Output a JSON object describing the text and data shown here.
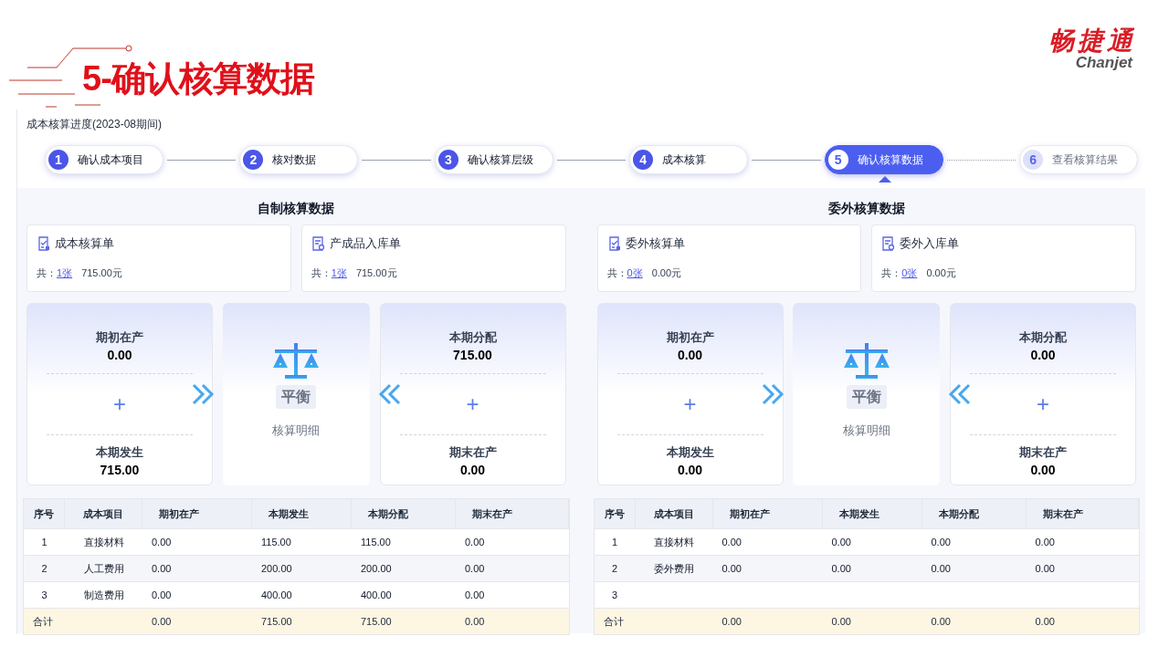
{
  "slide_title": "5-确认核算数据",
  "logo": {
    "name": "畅捷通",
    "latin": "Chanjet"
  },
  "progress": {
    "label": "成本核算进度(2023-08期间)",
    "steps": [
      {
        "number": "1",
        "label": "确认成本项目",
        "selected": false,
        "disabled": false
      },
      {
        "number": "2",
        "label": "核对数据",
        "selected": false,
        "disabled": false
      },
      {
        "number": "3",
        "label": "确认核算层级",
        "selected": false,
        "disabled": false
      },
      {
        "number": "4",
        "label": "成本核算",
        "selected": false,
        "disabled": false
      },
      {
        "number": "5",
        "label": "确认核算数据",
        "selected": true,
        "disabled": false
      },
      {
        "number": "6",
        "label": "查看核算结果",
        "selected": false,
        "disabled": true
      }
    ]
  },
  "sections": [
    {
      "title": "自制核算数据",
      "documents": [
        {
          "name": "成本核算单",
          "total_label": "共：",
          "count": "1张",
          "amount": "715.00元"
        },
        {
          "name": "产成品入库单",
          "total_label": "共：",
          "count": "1张",
          "amount": "715.00元"
        }
      ],
      "inputs": [
        {
          "label": "期初在产",
          "value": "0.00"
        },
        {
          "operator": "+"
        },
        {
          "label": "本期发生",
          "value": "715.00"
        }
      ],
      "balance": {
        "status": "平衡",
        "link": "核算明细"
      },
      "outputs": [
        {
          "label": "本期分配",
          "value": "715.00"
        },
        {
          "operator": "+"
        },
        {
          "label": "期末在产",
          "value": "0.00"
        }
      ],
      "table": {
        "columns": [
          "序号",
          "成本项目",
          "期初在产",
          "本期发生",
          "本期分配",
          "期末在产"
        ],
        "rows": [
          {
            "index": "1",
            "item": "直接材料",
            "values": [
              "0.00",
              "115.00",
              "115.00",
              "0.00"
            ]
          },
          {
            "index": "2",
            "item": "人工费用",
            "values": [
              "0.00",
              "200.00",
              "200.00",
              "0.00"
            ]
          },
          {
            "index": "3",
            "item": "制造费用",
            "values": [
              "0.00",
              "400.00",
              "400.00",
              "0.00"
            ]
          }
        ],
        "total": {
          "label": "合计",
          "values": [
            "0.00",
            "715.00",
            "715.00",
            "0.00"
          ]
        }
      }
    },
    {
      "title": "委外核算数据",
      "documents": [
        {
          "name": "委外核算单",
          "total_label": "共：",
          "count": "0张",
          "amount": "0.00元"
        },
        {
          "name": "委外入库单",
          "total_label": "共：",
          "count": "0张",
          "amount": "0.00元"
        }
      ],
      "inputs": [
        {
          "label": "期初在产",
          "value": "0.00"
        },
        {
          "operator": "+"
        },
        {
          "label": "本期发生",
          "value": "0.00"
        }
      ],
      "balance": {
        "status": "平衡",
        "link": "核算明细"
      },
      "outputs": [
        {
          "label": "本期分配",
          "value": "0.00"
        },
        {
          "operator": "+"
        },
        {
          "label": "期末在产",
          "value": "0.00"
        }
      ],
      "table": {
        "columns": [
          "序号",
          "成本项目",
          "期初在产",
          "本期发生",
          "本期分配",
          "期末在产"
        ],
        "rows": [
          {
            "index": "1",
            "item": "直接材料",
            "values": [
              "0.00",
              "0.00",
              "0.00",
              "0.00"
            ]
          },
          {
            "index": "2",
            "item": "委外费用",
            "values": [
              "0.00",
              "0.00",
              "0.00",
              "0.00"
            ]
          },
          {
            "index": "3"
          }
        ],
        "total": {
          "label": "合计",
          "values": [
            "0.00",
            "0.00",
            "0.00",
            "0.00"
          ]
        }
      }
    }
  ]
}
